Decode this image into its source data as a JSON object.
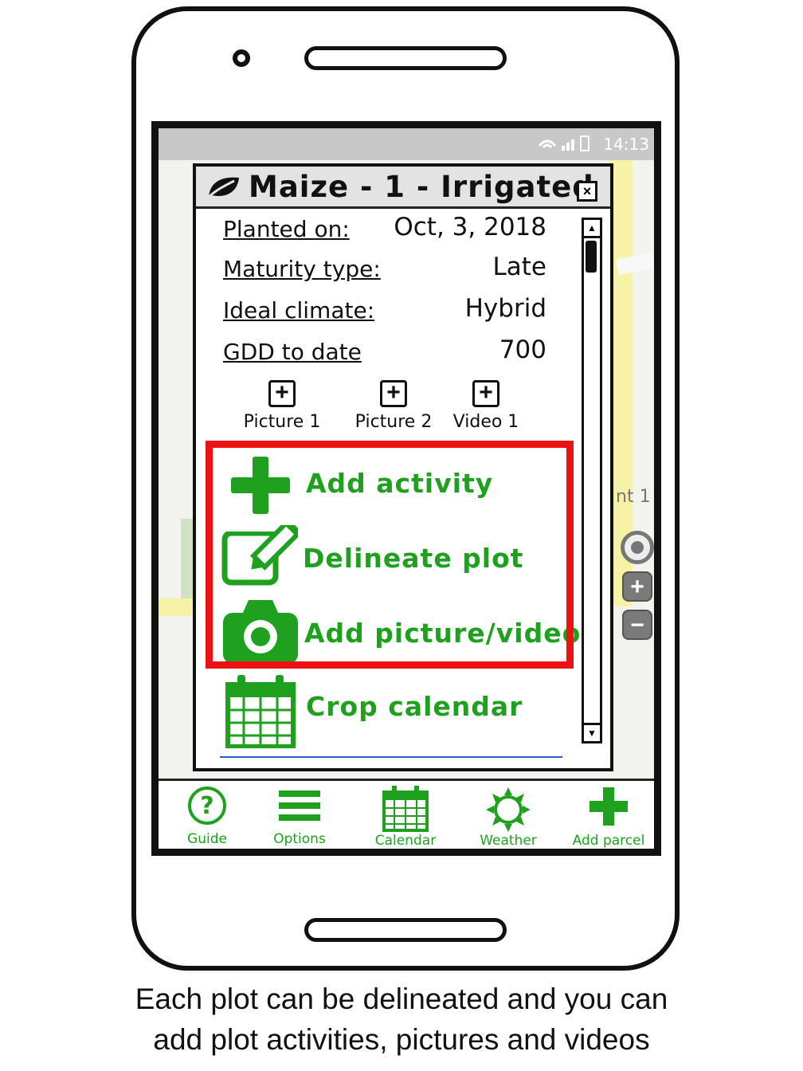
{
  "status_bar": {
    "time": "14:13",
    "icons": [
      "wifi-icon",
      "signal-icon",
      "battery-icon"
    ]
  },
  "map": {
    "partial_label": "nt 1",
    "controls": [
      "locate-icon",
      "zoom-in-icon",
      "zoom-out-icon"
    ]
  },
  "dialog": {
    "title": "Maize - 1  - Irrigated",
    "title_icon": "leaf-icon",
    "fields": [
      {
        "label": "Planted on:",
        "value": "Oct, 3, 2018"
      },
      {
        "label": "Maturity type:",
        "value": "Late"
      },
      {
        "label": "Ideal climate:",
        "value": "Hybrid"
      },
      {
        "label": "GDD to date",
        "value": "700"
      }
    ],
    "media_buttons": [
      {
        "label": "Picture 1"
      },
      {
        "label": "Picture 2"
      },
      {
        "label": "Video 1"
      }
    ],
    "actions": [
      {
        "label": "Add activity",
        "icon": "plus-icon"
      },
      {
        "label": "Delineate plot",
        "icon": "edit-icon"
      },
      {
        "label": "Add picture/video",
        "icon": "camera-icon"
      },
      {
        "label": "Crop calendar",
        "icon": "calendar-icon"
      }
    ]
  },
  "bottom_nav": [
    {
      "label": "Guide",
      "icon": "help-icon"
    },
    {
      "label": "Options",
      "icon": "menu-icon"
    },
    {
      "label": "Calendar",
      "icon": "calendar-icon"
    },
    {
      "label": "Weather",
      "icon": "sun-icon"
    },
    {
      "label": "Add parcel",
      "icon": "plus-icon"
    }
  ],
  "colors": {
    "accent_green": "#1fa01f",
    "highlight_red": "#ee1111"
  },
  "caption": {
    "line1": "Each plot can be delineated and you can",
    "line2": "add plot activities, pictures and videos"
  }
}
